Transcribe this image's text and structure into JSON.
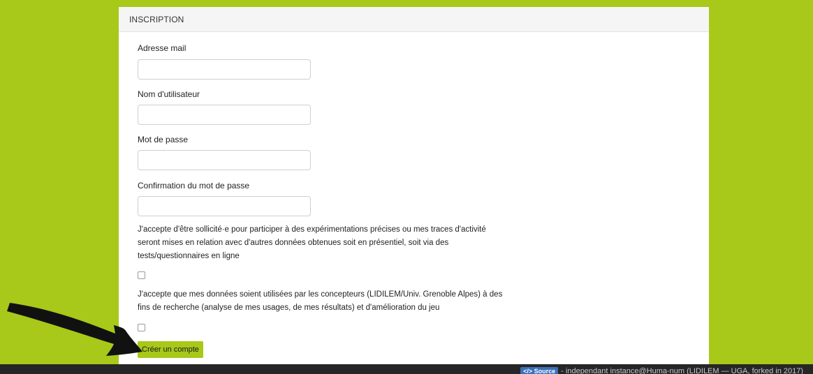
{
  "card": {
    "header_title": "INSCRIPTION"
  },
  "form": {
    "email_label": "Adresse mail",
    "email_value": "",
    "username_label": "Nom d'utilisateur",
    "username_value": "",
    "password_label": "Mot de passe",
    "password_value": "",
    "confirm_label": "Confirmation du mot de passe",
    "confirm_value": "",
    "consent_experiments_text": "J'accepte d'être sollicité·e pour participer à des expérimentations précises ou mes traces d'activité seront mises en relation avec d'autres données obtenues soit en présentiel, soit via des tests/questionnaires en ligne",
    "consent_experiments_checked": false,
    "consent_research_text": "J'accepte que mes données soient utilisées par les concepteurs (LIDILEM/Univ. Grenoble Alpes) à des fins de recherche (analyse de mes usages, de mes résultats) et d'amélioration du jeu",
    "consent_research_checked": false,
    "submit_label": "Créer un compte"
  },
  "footer": {
    "source_badge": "</> Source",
    "text": "- independant instance@Huma-num (LIDILEM — UGA, forked in 2017)"
  },
  "colors": {
    "background": "#a8c81a",
    "button": "#a8c81a",
    "footer": "#262626",
    "arrow": "#111111"
  },
  "icons": {
    "annotation_arrow": "arrow-pointing-to-submit-icon"
  }
}
